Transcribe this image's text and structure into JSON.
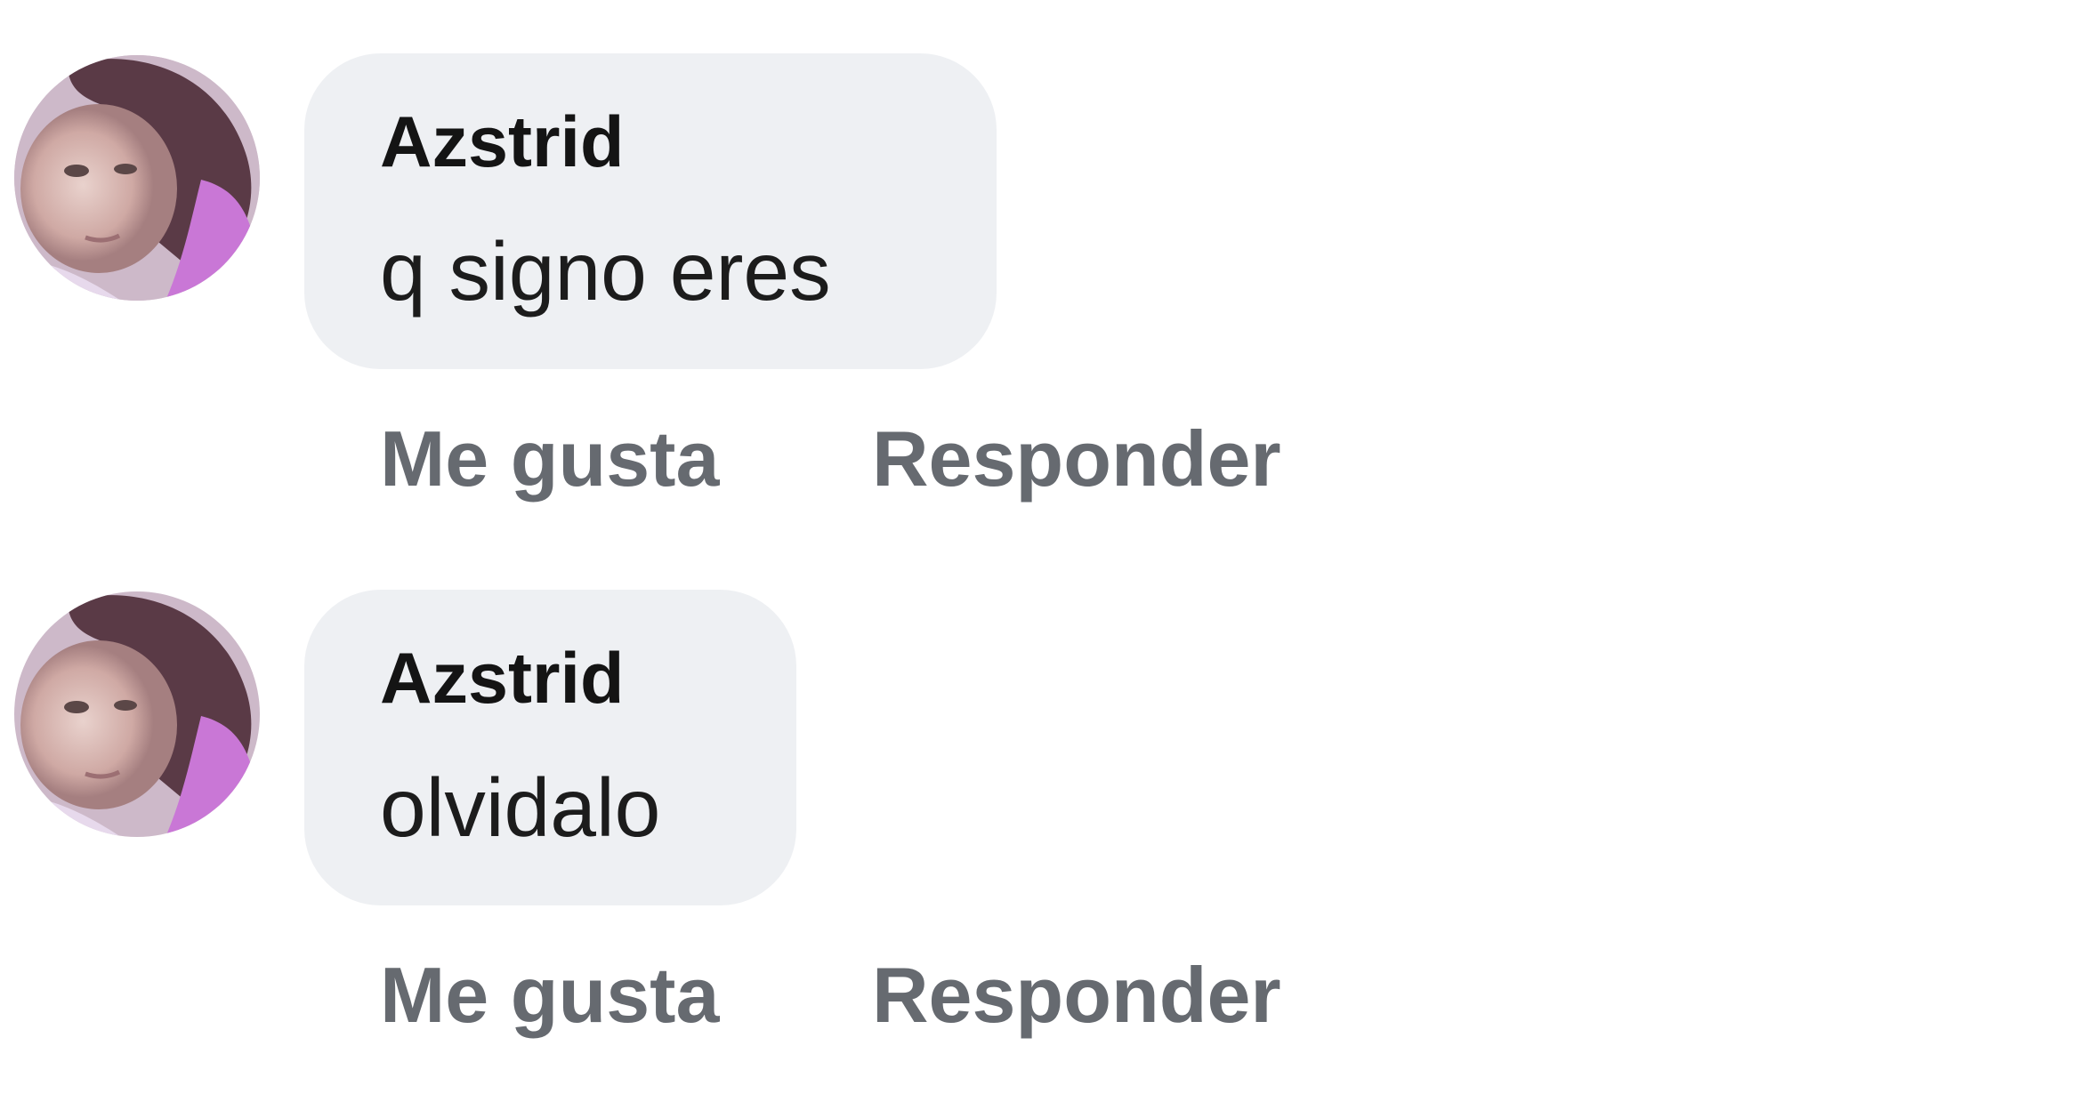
{
  "colors": {
    "background": "#ffffff",
    "bubble": "#eef0f3",
    "author": "#141414",
    "text": "#1c1c1c",
    "action": "#666a70"
  },
  "comments": [
    {
      "author": "Azstrid",
      "text": "q signo eres",
      "avatar_icon": "profile-photo",
      "actions": {
        "like": "Me gusta",
        "reply": "Responder"
      }
    },
    {
      "author": "Azstrid",
      "text": "olvidalo",
      "avatar_icon": "profile-photo",
      "actions": {
        "like": "Me gusta",
        "reply": "Responder"
      }
    }
  ]
}
